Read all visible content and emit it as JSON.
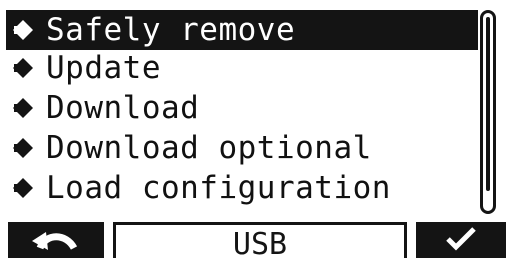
{
  "menu": {
    "items": [
      {
        "label": "Safely remove",
        "selected": true
      },
      {
        "label": "Update",
        "selected": false
      },
      {
        "label": "Download",
        "selected": false
      },
      {
        "label": "Download optional",
        "selected": false
      },
      {
        "label": "Load configuration",
        "selected": false
      }
    ]
  },
  "softkeys": {
    "left_icon": "back-arrow-icon",
    "center_label": "USB",
    "right_icon": "checkmark-icon"
  },
  "colors": {
    "foreground": "#141414",
    "background": "#ffffff"
  }
}
